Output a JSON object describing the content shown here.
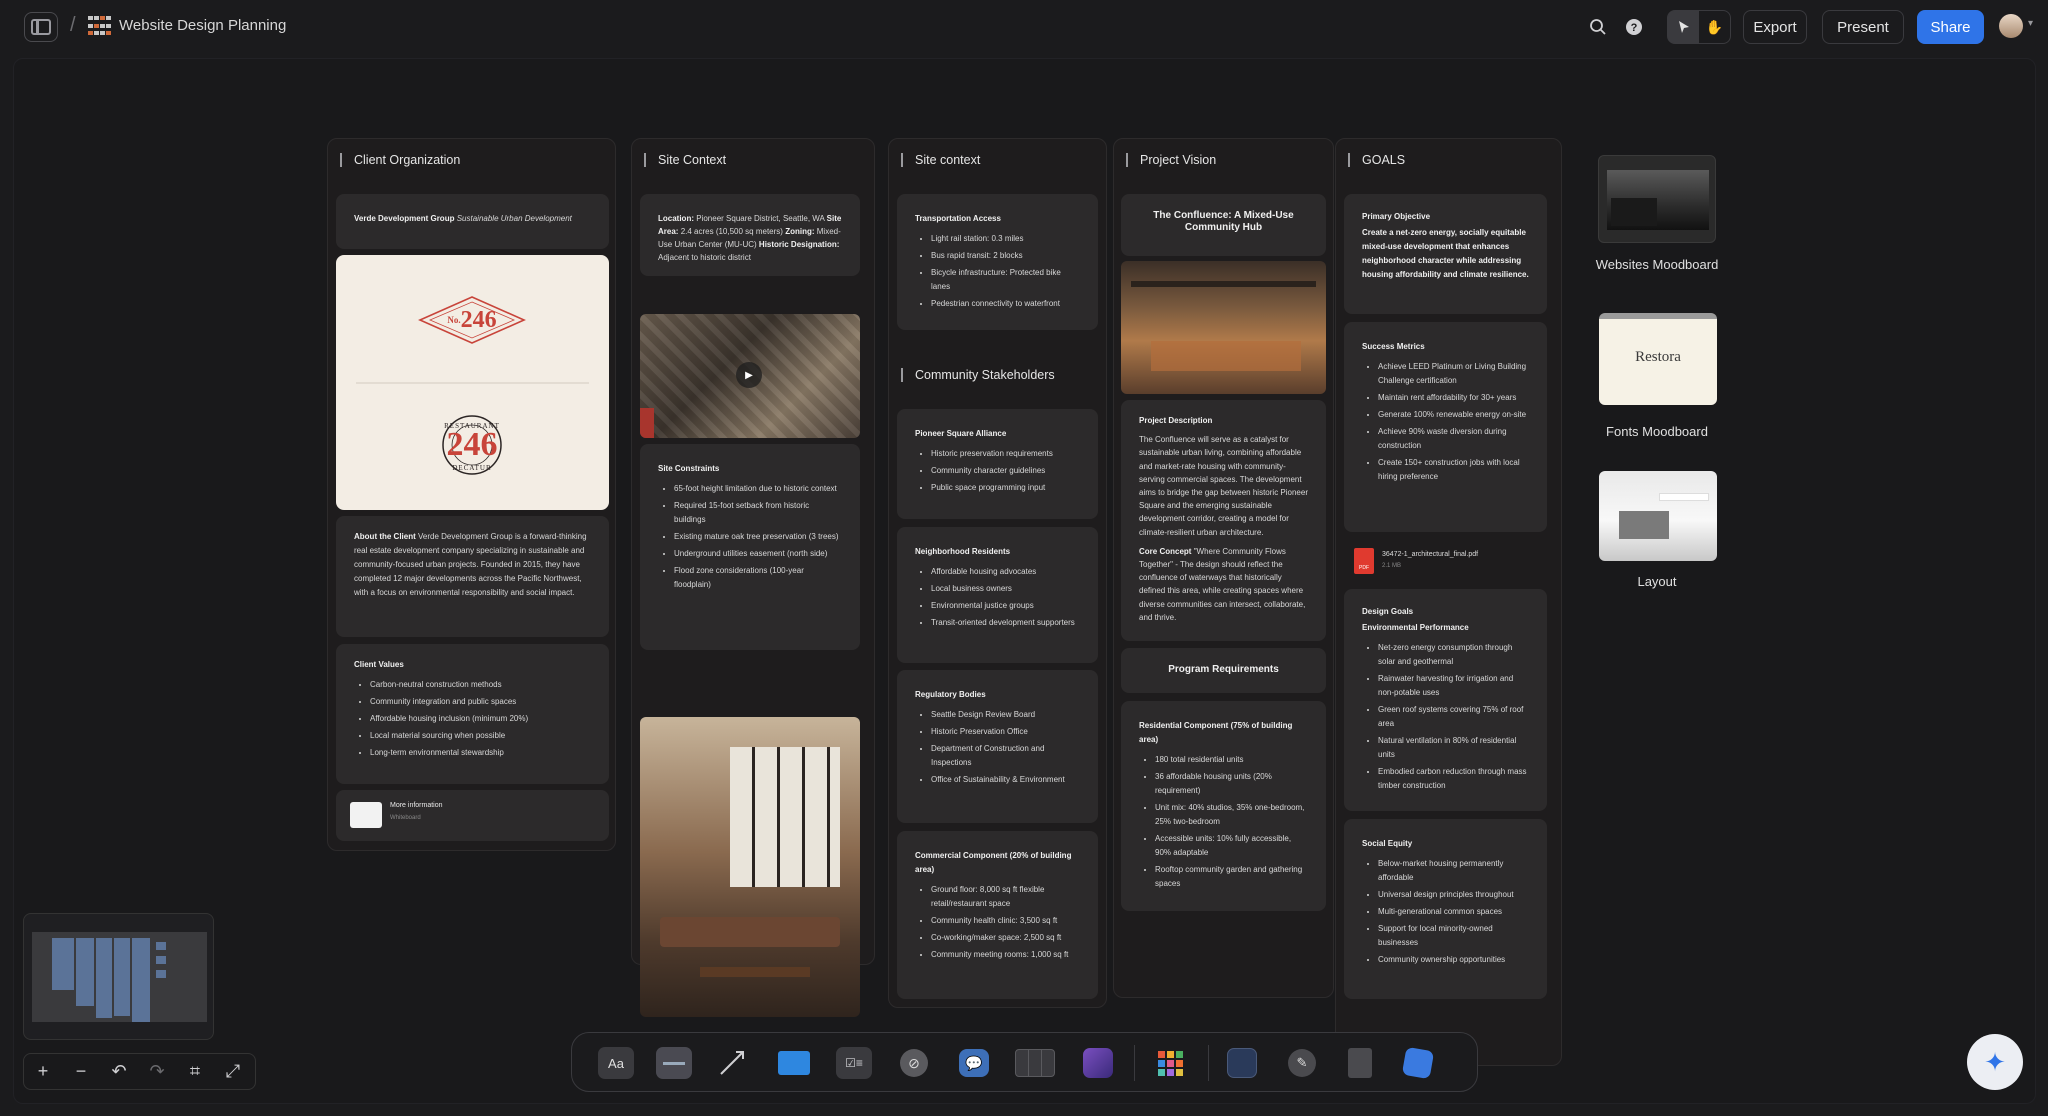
{
  "header": {
    "title": "Website Design Planning",
    "export": "Export",
    "present": "Present",
    "share": "Share"
  },
  "columns": {
    "client": {
      "title": "Client Organization",
      "org_name": "Verde Development Group",
      "org_tag": "Sustainable Urban Development",
      "logo_top": "246",
      "logo_top_prefix": "No.",
      "logo_ring_top": "RESTAURANT",
      "logo_ring_bottom": "DECATUR",
      "logo_bottom": "246",
      "about_label": "About the Client",
      "about_text": "Verde Development Group is a forward-thinking real estate development company specializing in sustainable and community-focused urban projects. Founded in 2015, they have completed 12 major developments across the Pacific Northwest, with a focus on environmental responsibility and social impact.",
      "values_title": "Client Values",
      "values": [
        "Carbon-neutral construction methods",
        "Community integration and public spaces",
        "Affordable housing inclusion (minimum 20%)",
        "Local material sourcing when possible",
        "Long-term environmental stewardship"
      ],
      "more_title": "More information",
      "more_sub": "Whiteboard"
    },
    "site1": {
      "title": "Site Context",
      "loc_label": "Location:",
      "loc": "Pioneer Square District, Seattle, WA",
      "area_label": "Site Area:",
      "area": "2.4 acres (10,500 sq meters)",
      "zoning_label": "Zoning:",
      "zoning": "Mixed-Use Urban Center (MU-UC)",
      "hist_label": "Historic Designation:",
      "hist": "Adjacent to historic district",
      "constraints_title": "Site Constraints",
      "constraints": [
        "65-foot height limitation due to historic context",
        "Required 15-foot setback from historic buildings",
        "Existing mature oak tree preservation (3 trees)",
        "Underground utilities easement (north side)",
        "Flood zone considerations (100-year floodplain)"
      ]
    },
    "site2": {
      "title": "Site context",
      "transport_title": "Transportation Access",
      "transport": [
        "Light rail station: 0.3 miles",
        "Bus rapid transit: 2 blocks",
        "Bicycle infrastructure: Protected bike lanes",
        "Pedestrian connectivity to waterfront"
      ],
      "stake_title": "Community Stakeholders",
      "alliance_title": "Pioneer Square Alliance",
      "alliance": [
        "Historic preservation requirements",
        "Community character guidelines",
        "Public space programming input"
      ],
      "residents_title": "Neighborhood Residents",
      "residents": [
        "Affordable housing advocates",
        "Local business owners",
        "Environmental justice groups",
        "Transit-oriented development supporters"
      ],
      "reg_title": "Regulatory Bodies",
      "reg": [
        "Seattle Design Review Board",
        "Historic Preservation Office",
        "Department of Construction and Inspections",
        "Office of Sustainability & Environment"
      ],
      "commercial_title": "Commercial Component (20% of building area)",
      "commercial": [
        "Ground floor: 8,000 sq ft flexible retail/restaurant space",
        "Community health clinic: 3,500 sq ft",
        "Co-working/maker space: 2,500 sq ft",
        "Community meeting rooms: 1,000 sq ft"
      ]
    },
    "vision": {
      "title": "Project Vision",
      "headline": "The Confluence: A Mixed-Use Community Hub",
      "desc_title": "Project Description",
      "desc": "The Confluence will serve as a catalyst for sustainable urban living, combining affordable and market-rate housing with community-serving commercial spaces. The development aims to bridge the gap between historic Pioneer Square and the emerging sustainable development corridor, creating a model for climate-resilient urban architecture.",
      "core_label": "Core Concept",
      "core": "\"Where Community Flows Together\" - The design should reflect the confluence of waterways that historically defined this area, while creating spaces where diverse communities can intersect, collaborate, and thrive.",
      "program_title": "Program Requirements",
      "res_title": "Residential Component (75% of building area)",
      "res": [
        "180 total residential units",
        "36 affordable housing units (20% requirement)",
        "Unit mix: 40% studios, 35% one-bedroom, 25% two-bedroom",
        "Accessible units: 10% fully accessible, 90% adaptable",
        "Rooftop community garden and gathering spaces"
      ]
    },
    "goals": {
      "title": "GOALS",
      "primary_title": "Primary Objective",
      "primary": "Create a net-zero energy, socially equitable mixed-use development that enhances neighborhood character while addressing housing affordability and climate resilience.",
      "metrics_title": "Success Metrics",
      "metrics": [
        "Achieve LEED Platinum or Living Building Challenge certification",
        "Maintain rent affordability for 30+ years",
        "Generate 100% renewable energy on-site",
        "Achieve 90% waste diversion during construction",
        "Create 150+ construction jobs with local hiring preference"
      ],
      "pdf_name": "36472-1_architectural_final.pdf",
      "pdf_size": "2.1 MB",
      "pdf_badge": "PDF",
      "design_title": "Design Goals",
      "env_title": "Environmental Performance",
      "env": [
        "Net-zero energy consumption through solar and geothermal",
        "Rainwater harvesting for irrigation and non-potable uses",
        "Green roof systems covering 75% of roof area",
        "Natural ventilation in 80% of residential units",
        "Embodied carbon reduction through mass timber construction"
      ],
      "social_title": "Social Equity",
      "social": [
        "Below-market housing permanently affordable",
        "Universal design principles throughout",
        "Multi-generational common spaces",
        "Support for local minority-owned businesses",
        "Community ownership opportunities"
      ]
    }
  },
  "side": {
    "websites": "Websites Moodboard",
    "fonts": "Fonts Moodboard",
    "fonts_sample": "Restora",
    "layout": "Layout"
  },
  "dock": {
    "text_tool": "Aa"
  },
  "colors": {
    "accent": "#2f74e8",
    "logo_red": "#c8443a",
    "logo_bg": "#f3ede4"
  }
}
